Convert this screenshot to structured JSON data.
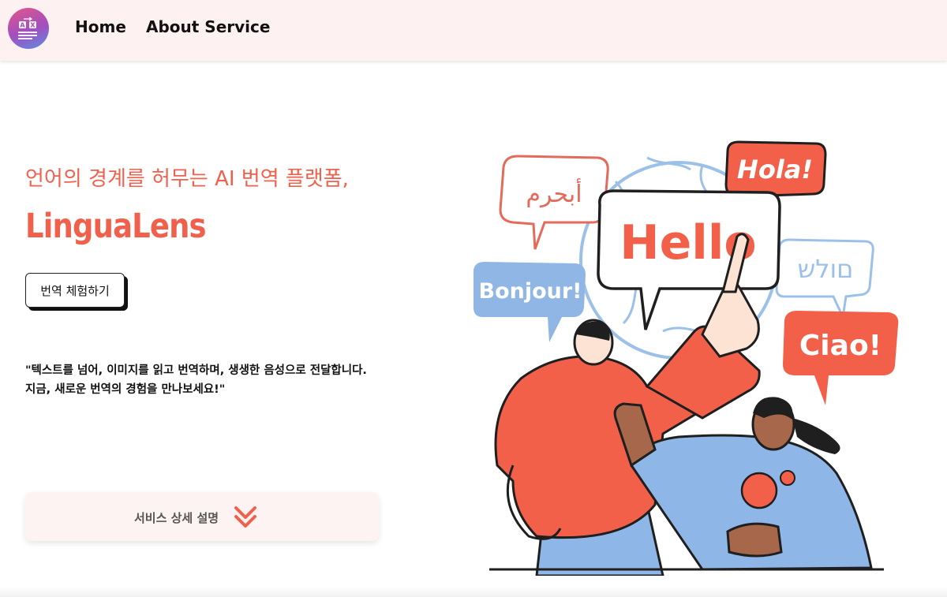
{
  "nav": {
    "logo_alt": "LinguaLens logo",
    "links": [
      {
        "label": "Home"
      },
      {
        "label": "About Service"
      }
    ]
  },
  "hero": {
    "tagline": "언어의 경계를 허무는 AI 번역 플랫폼,",
    "title": "LinguaLens",
    "cta_label": "번역 체험하기",
    "description_lines": [
      "\"텍스트를 넘어, 이미지를 읽고 번역하며, 생생한 음성으로 전달합니다.",
      "지금, 새로운 번역의 경험을 만나보세요!\""
    ]
  },
  "detail_button": {
    "label": "서비스 상세 설명",
    "icon": "double-chevron-down-icon"
  },
  "illustration": {
    "bubbles": {
      "arabic": "أبحرم",
      "hola": "Hola!",
      "hello": "Hello",
      "hebrew": "םולש",
      "bonjour": "Bonjour!",
      "ciao": "Ciao!"
    }
  },
  "colors": {
    "accent": "#f0614d",
    "nav_bg": "#fdf1f1",
    "bubble_blue": "#8fb6e4",
    "shirt_blue": "#8eb6e6",
    "hoodie_red": "#f2604a"
  }
}
